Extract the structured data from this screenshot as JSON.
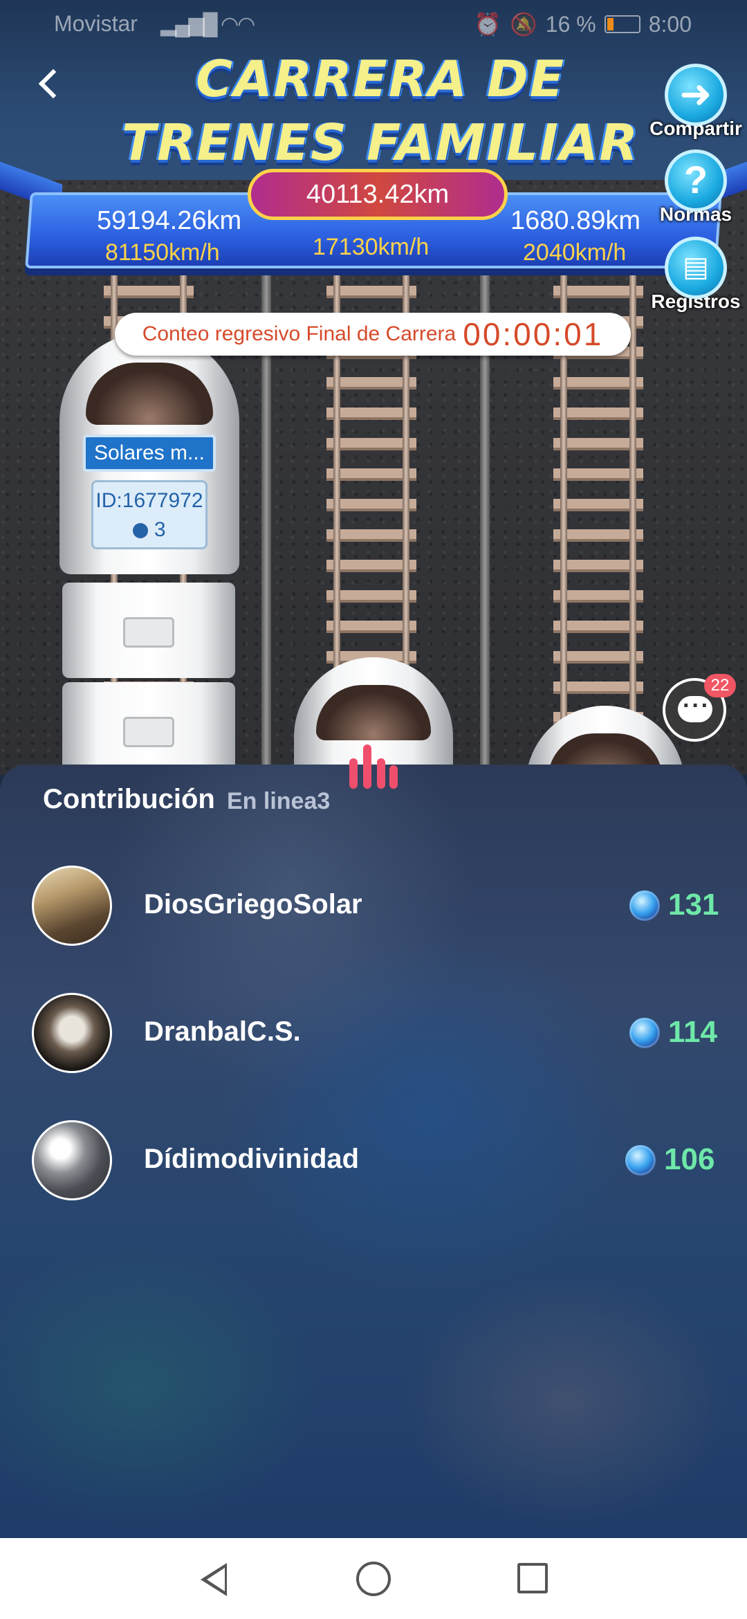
{
  "status_bar": {
    "carrier": "Movistar",
    "battery_percent": "16 %",
    "time": "8:00"
  },
  "header": {
    "title_line1": "CARRERA DE",
    "title_line2": "TRENES FAMILIAR"
  },
  "scoreboard": {
    "total_distance": "40113.42km",
    "left_distance": "59194.26km",
    "left_speed": "81150km/h",
    "center_speed": "17130km/h",
    "right_distance": "1680.89km",
    "right_speed": "2040km/h"
  },
  "side_buttons": {
    "share_label": "Compartir",
    "rules_label": "Normas",
    "records_label": "Registros"
  },
  "countdown": {
    "label": "Conteo regresivo Final de Carrera",
    "time": "00:00:01"
  },
  "train": {
    "name": "Solares m...",
    "id": "ID:1677972",
    "members": "3"
  },
  "chat": {
    "badge": "22"
  },
  "contribution": {
    "title": "Contribución",
    "subtitle": "En linea3",
    "rows": [
      {
        "name": "DiosGriegoSolar",
        "score": "131"
      },
      {
        "name": "DranbalC.S.",
        "score": "114"
      },
      {
        "name": "Dídimodivinidad",
        "score": "106"
      }
    ]
  },
  "colors": {
    "accent_title": "#f6f08a",
    "speed_yellow": "#ffd24a",
    "score_green": "#6ee8a8",
    "countdown_red": "#d64a2a",
    "badge_red": "#f05663"
  }
}
